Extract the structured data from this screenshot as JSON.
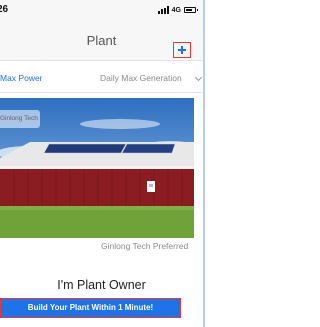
{
  "status_bar": {
    "time": "26",
    "network": "4G",
    "icons": [
      "signal-icon",
      "battery-icon"
    ]
  },
  "nav": {
    "title": "Plant",
    "add_icon": "plus-icon"
  },
  "tabs": [
    {
      "label": "Max Power",
      "selected": true
    },
    {
      "label": "Daily Max Generation",
      "selected": false
    }
  ],
  "hero": {
    "watermark": "Ginlong Tech",
    "caption": "Ginlong Tech Preferred"
  },
  "main": {
    "heading": "I'm Plant Owner",
    "cta_label": "Build Your Plant Within 1 Minute!"
  },
  "colors": {
    "accent": "#1e73e8",
    "highlight_border": "#e53935",
    "barn": "#8a1c22",
    "grass": "#6fa33a",
    "sky": "#3f7fc9"
  }
}
